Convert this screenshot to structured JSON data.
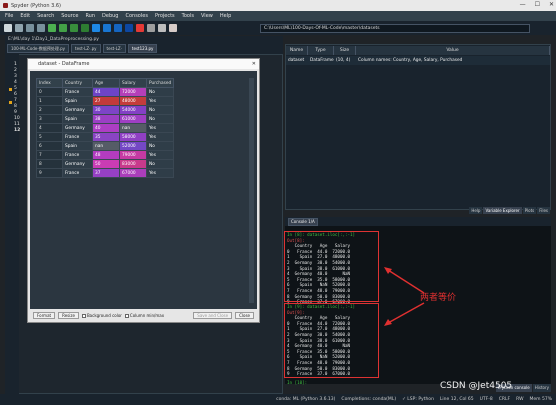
{
  "window": {
    "title": "Spyder (Python 3.6)",
    "minimize": "—",
    "maximize": "☐",
    "close": "✕"
  },
  "menu": [
    "File",
    "Edit",
    "Search",
    "Source",
    "Run",
    "Debug",
    "Consoles",
    "Projects",
    "Tools",
    "View",
    "Help"
  ],
  "toolbar": {
    "path": "C:\\Users\\ML\\100-Days-Of-ML-Code\\master\\datasets"
  },
  "editor": {
    "path": "E:\\ML\\day 1\\Day1_DataPreprocessing.py",
    "tabs": [
      "100-ML-Code-数据预处理.py",
      "test-LZ·.py",
      "test-LZ·",
      "test123.py"
    ],
    "line_numbers": [
      "1",
      "2",
      "3",
      "4",
      "5",
      "6",
      "7",
      "8",
      "9",
      "10",
      "11",
      "12"
    ]
  },
  "dataframe_dialog": {
    "title": "dataset - DataFrame",
    "close": "✕",
    "columns": [
      "Index",
      "Country",
      "Age",
      "Salary",
      "Purchased"
    ],
    "rows": [
      {
        "index": "0",
        "country": "France",
        "age": "44",
        "salary": "72000",
        "purchased": "No"
      },
      {
        "index": "1",
        "country": "Spain",
        "age": "27",
        "salary": "48000",
        "purchased": "Yes"
      },
      {
        "index": "2",
        "country": "Germany",
        "age": "30",
        "salary": "54000",
        "purchased": "No"
      },
      {
        "index": "3",
        "country": "Spain",
        "age": "38",
        "salary": "61000",
        "purchased": "No"
      },
      {
        "index": "4",
        "country": "Germany",
        "age": "40",
        "salary": "nan",
        "purchased": "Yes"
      },
      {
        "index": "5",
        "country": "France",
        "age": "35",
        "salary": "58000",
        "purchased": "Yes"
      },
      {
        "index": "6",
        "country": "Spain",
        "age": "nan",
        "salary": "52000",
        "purchased": "No"
      },
      {
        "index": "7",
        "country": "France",
        "age": "48",
        "salary": "79000",
        "purchased": "Yes"
      },
      {
        "index": "8",
        "country": "Germany",
        "age": "50",
        "salary": "83000",
        "purchased": "No"
      },
      {
        "index": "9",
        "country": "France",
        "age": "37",
        "salary": "67000",
        "purchased": "Yes"
      }
    ],
    "age_colors": [
      "#6d44c7",
      "#c23a3a",
      "#7d44c7",
      "#9b3fc4",
      "#ad3ec4",
      "#8a44c4",
      "#555c66",
      "#b33cc0",
      "#c93cb4",
      "#9640c4"
    ],
    "salary_colors": [
      "#b53fb9",
      "#c43c3c",
      "#8440c5",
      "#9f3fc3",
      "#555c66",
      "#9040c4",
      "#7448c5",
      "#c53aa3",
      "#c83a8c",
      "#ab3ebb"
    ],
    "buttons": {
      "format": "Format",
      "resize": "Resize",
      "background": "Background color",
      "column_minmax": "Column min/max",
      "save_close": "Save and Close",
      "close": "Close"
    }
  },
  "variable_explorer": {
    "headers": [
      "Name",
      "Type",
      "Size",
      "Value"
    ],
    "row": {
      "name": "dataset",
      "type": "DataFrame",
      "size": "(10, 4)",
      "value": "Column names: Country, Age, Salary, Purchased"
    },
    "tabs": [
      "Help",
      "Variable Explorer",
      "Plots",
      "Files"
    ]
  },
  "console": {
    "tab": "Console 1/A",
    "block1": {
      "prompt": "In [8]: dataset.iloc[:,:-1]",
      "out": "Out[8]:",
      "header": "   Country   Age   Salary",
      "rows": [
        "0   France  44.0  72000.0",
        "1    Spain  27.0  48000.0",
        "2  Germany  30.0  54000.0",
        "3    Spain  38.0  61000.0",
        "4  Germany  40.0      NaN",
        "5   France  35.0  58000.0",
        "6    Spain   NaN  52000.0",
        "7   France  48.0  79000.0",
        "8  Germany  50.0  83000.0",
        "9   France  37.0  67000.0"
      ]
    },
    "block2": {
      "prompt": "In [9]: dataset.iloc[:,:-1]",
      "out": "Out[9]:",
      "header": "   Country   Age   Salary",
      "rows": [
        "0   France  44.0  72000.0",
        "1    Spain  27.0  48000.0",
        "2  Germany  30.0  54000.0",
        "3    Spain  38.0  61000.0",
        "4  Germany  40.0      NaN",
        "5   France  35.0  58000.0",
        "6    Spain   NaN  52000.0",
        "7   France  48.0  79000.0",
        "8  Germany  50.0  83000.0",
        "9   France  37.0  67000.0"
      ]
    },
    "final_prompt": "In [10]:",
    "annotation": "两者等价",
    "bottom_tabs": [
      "IPython console",
      "History"
    ]
  },
  "statusbar": [
    "conda: ML (Python 3.6.13)",
    "Completions: conda(ML)",
    "✓ LSP: Python",
    "Line 12, Col 65",
    "UTF-8",
    "CRLF",
    "RW",
    "Mem 57%"
  ],
  "watermark": "CSDN @Jet4505"
}
